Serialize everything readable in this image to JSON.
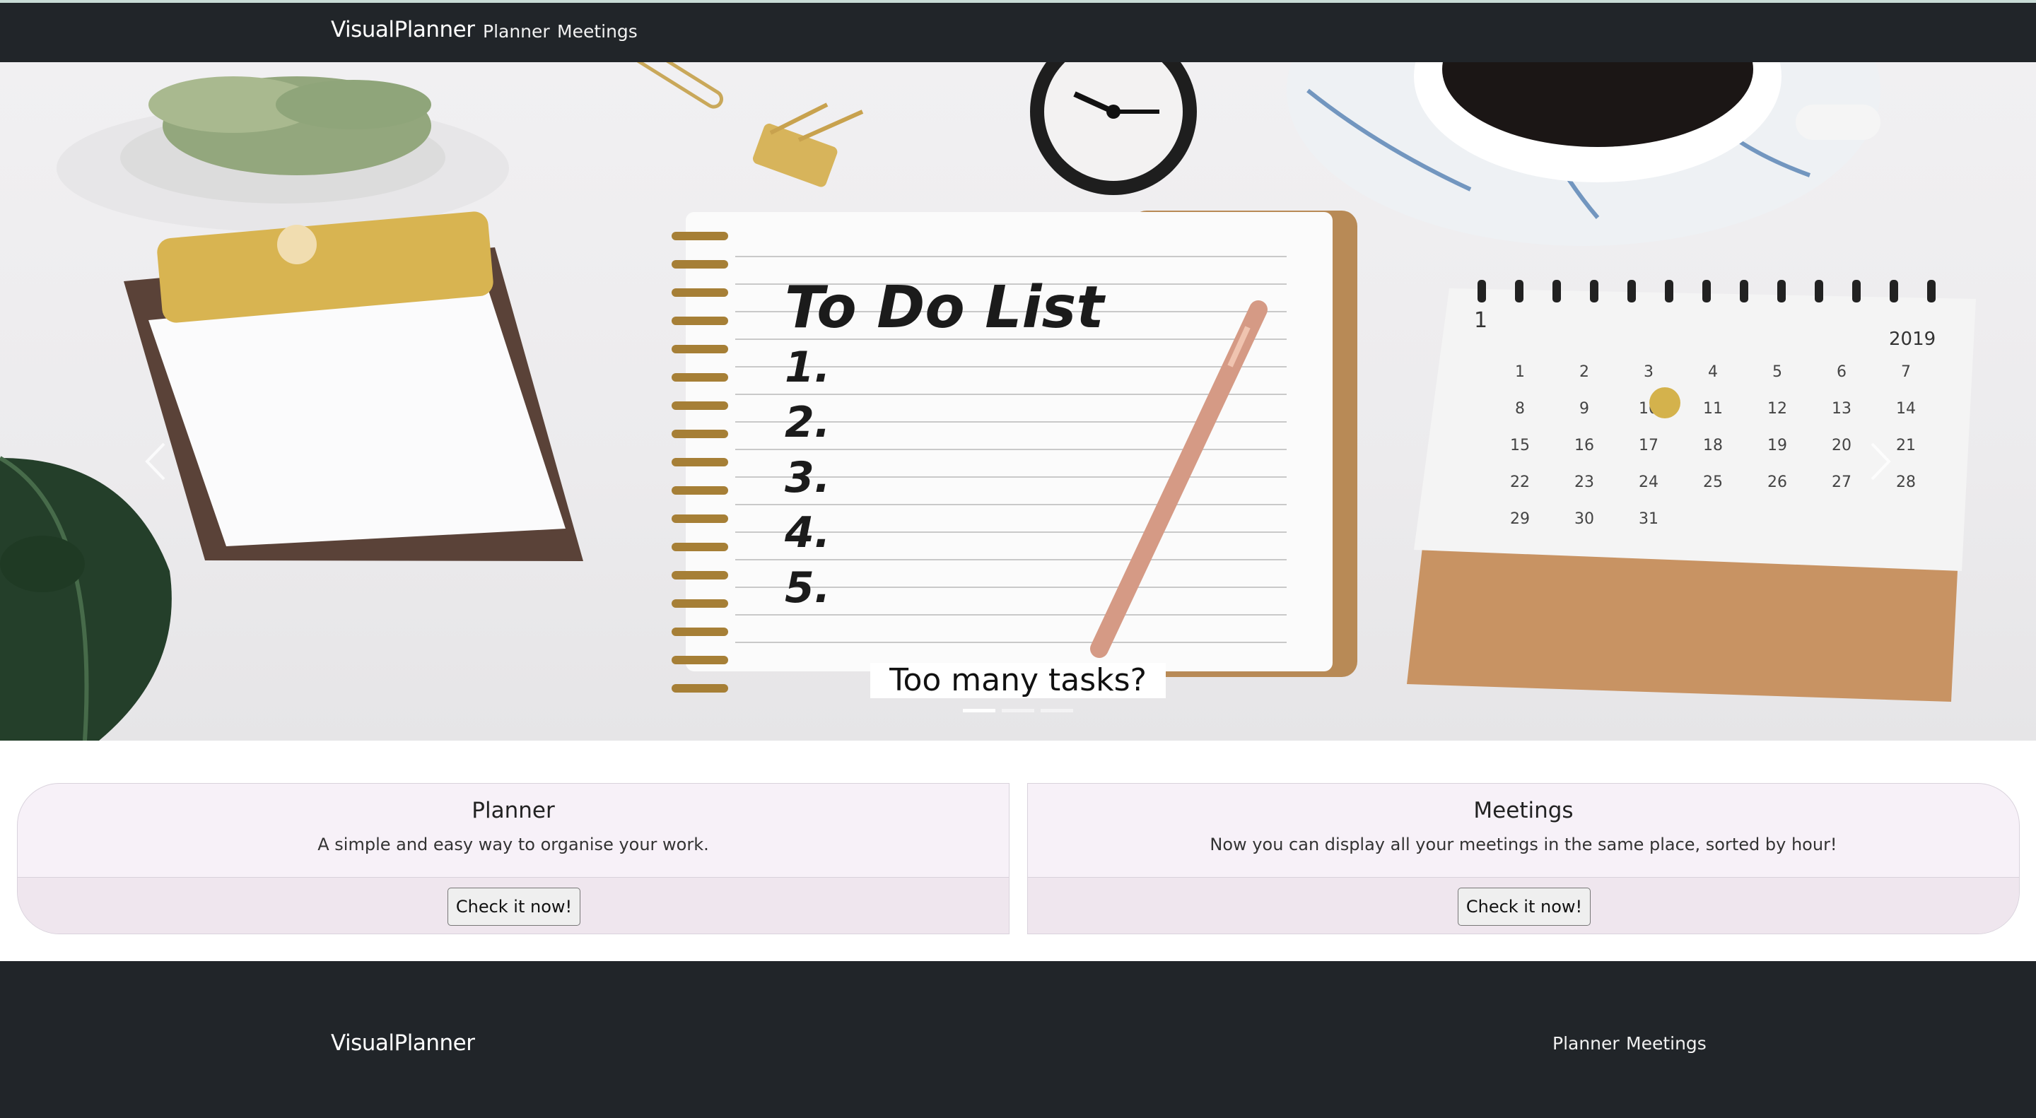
{
  "navbar": {
    "brand": "VisualPlanner",
    "links": [
      "Planner",
      "Meetings"
    ]
  },
  "hero": {
    "caption": "Too many tasks?",
    "notebook_heading": "To Do List",
    "notebook_items": [
      "1.",
      "2.",
      "3.",
      "4.",
      "5."
    ],
    "calendar_year": "2019",
    "calendar_month": "1",
    "calendar_days": [
      "1",
      "2",
      "3",
      "4",
      "5",
      "6",
      "7",
      "8",
      "9",
      "10",
      "11",
      "12",
      "13",
      "14",
      "15",
      "16",
      "17",
      "18",
      "19",
      "20",
      "21",
      "22",
      "23",
      "24",
      "25",
      "26",
      "27",
      "28",
      "29",
      "30",
      "31"
    ],
    "indicators": 3,
    "active_indicator": 0
  },
  "cards": [
    {
      "title": "Planner",
      "text": "A simple and easy way to organise your work.",
      "button": "Check it now!"
    },
    {
      "title": "Meetings",
      "text": "Now you can display all your meetings in the same place, sorted by hour!",
      "button": "Check it now!"
    }
  ],
  "footer": {
    "brand": "VisualPlanner",
    "links": [
      "Planner",
      "Meetings"
    ]
  },
  "colors": {
    "navbar_bg": "#212529",
    "card_bg": "#f7f1f8",
    "card_footer_bg": "#efe6ee"
  }
}
